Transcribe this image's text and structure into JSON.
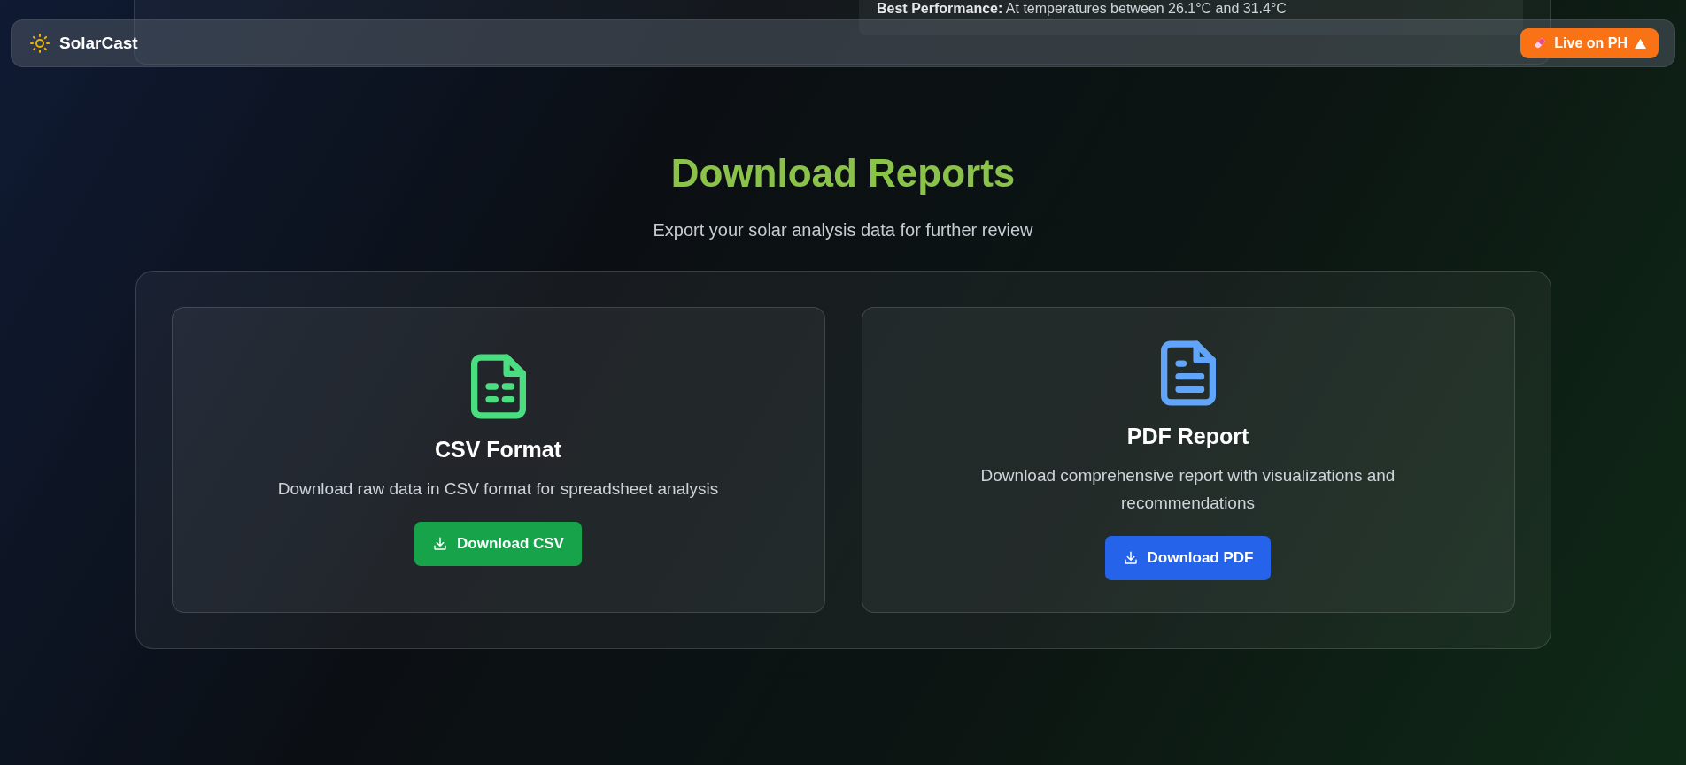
{
  "navbar": {
    "brand": "SolarCast",
    "badge": "Live on PH"
  },
  "partial_card": {
    "note": "**Best Performance:** At temperatures between 26.1°C and 31.4°C"
  },
  "header": {
    "title": "Download Reports",
    "subtitle": "Export your solar analysis data for further review"
  },
  "cards": [
    {
      "kind": "csv",
      "title": "CSV Format",
      "description": "Download raw data in CSV format for spreadsheet analysis",
      "button": "Download CSV"
    },
    {
      "kind": "pdf",
      "title": "PDF Report",
      "description": "Download comprehensive report with visualizations and recommendations",
      "button": "Download PDF"
    }
  ]
}
